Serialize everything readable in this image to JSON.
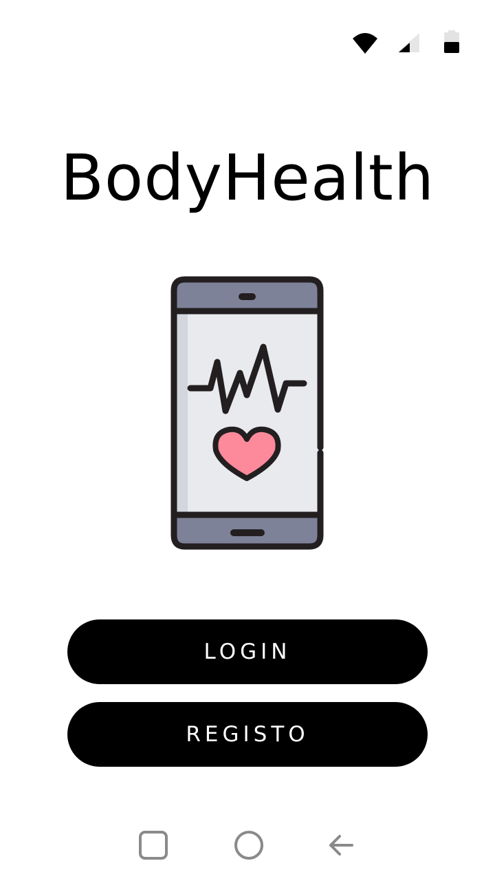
{
  "status_bar": {
    "icons": [
      "wifi-icon",
      "signal-icon",
      "battery-icon"
    ]
  },
  "app": {
    "title": "BodyHealth"
  },
  "hero": {
    "icon": "phone-heartbeat-icon",
    "colors": {
      "outline": "#231f20",
      "bezel": "#7e8299",
      "screen": "#e9eaee",
      "screen_edge": "#d4d6de",
      "heart": "#fc8a9b",
      "heart_shade": "#f4667d"
    }
  },
  "buttons": {
    "login_label": "LOGIN",
    "register_label": "REGISTO",
    "background": "#000000",
    "text_color": "#ffffff"
  },
  "nav_bar": {
    "icons": [
      "recents-icon",
      "home-icon",
      "back-icon"
    ],
    "color": "#8a8a8a"
  }
}
